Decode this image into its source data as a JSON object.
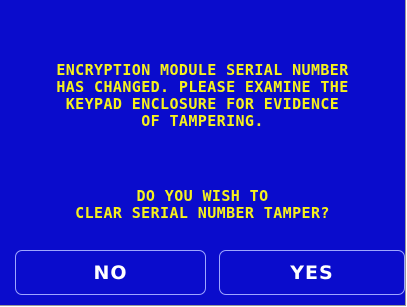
{
  "message": {
    "lines": [
      "ENCRYPTION MODULE SERIAL NUMBER",
      "HAS CHANGED. PLEASE EXAMINE THE",
      "KEYPAD ENCLOSURE FOR EVIDENCE",
      "OF TAMPERING."
    ]
  },
  "question": {
    "lines": [
      "DO YOU WISH TO",
      "CLEAR SERIAL NUMBER TAMPER?"
    ]
  },
  "buttons": {
    "no_label": "NO",
    "yes_label": "YES"
  },
  "colors": {
    "background": "#0a0ccc",
    "text": "#f7f21c",
    "button_text": "#ffffff",
    "button_border": "#9ea6ff"
  }
}
